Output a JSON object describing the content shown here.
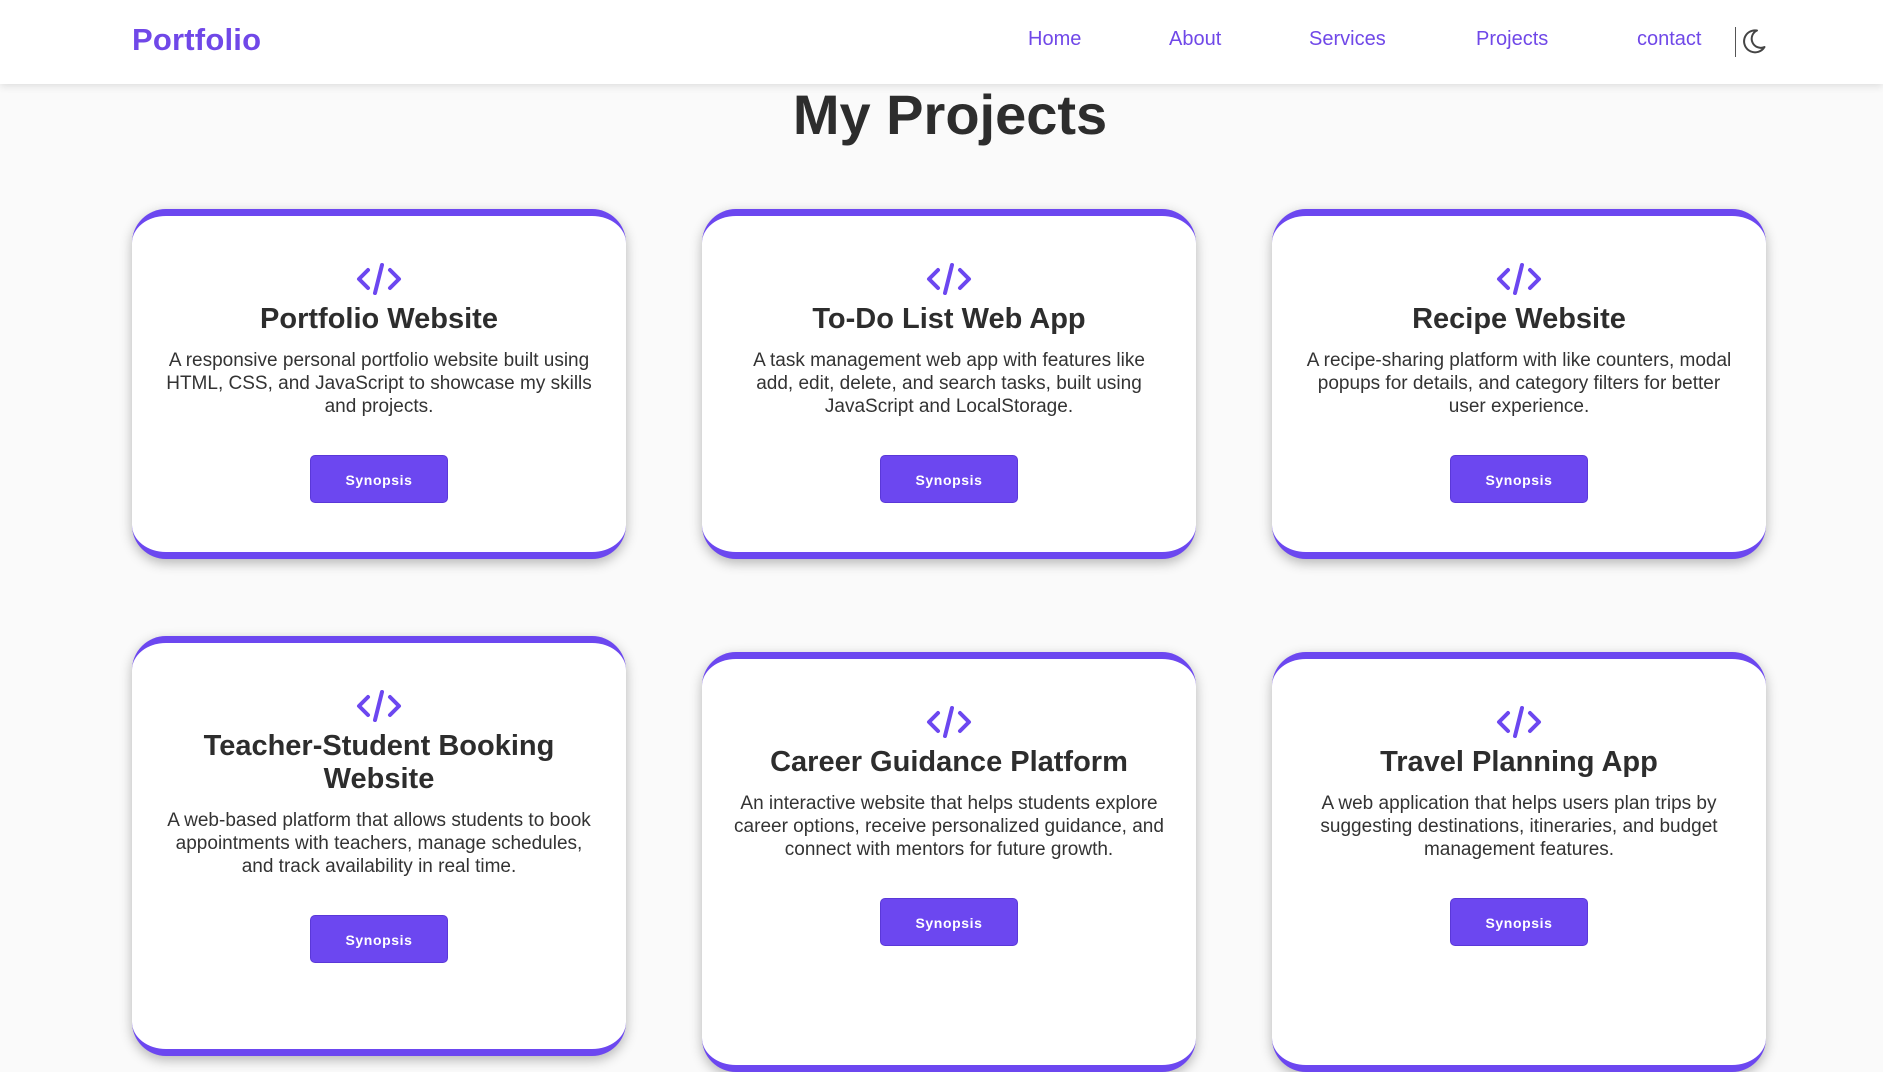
{
  "nav": {
    "logo": "Portfolio",
    "links": [
      "Home",
      "About",
      "Services",
      "Projects",
      "contact"
    ],
    "theme_icon": "moon-icon"
  },
  "page_title": "My Projects",
  "colors": {
    "accent": "#6c47f0",
    "link": "#7048e8",
    "text": "#2d2d2d",
    "background": "#fafafa"
  },
  "projects": [
    {
      "icon": "code-icon",
      "title": "Portfolio Website",
      "description": "A responsive personal portfolio website built using HTML, CSS, and JavaScript to showcase my skills and projects.",
      "button": "Synopsis"
    },
    {
      "icon": "code-icon",
      "title": "To-Do List Web App",
      "description": "A task management web app with features like add, edit, delete, and search tasks, built using JavaScript and LocalStorage.",
      "button": "Synopsis"
    },
    {
      "icon": "code-icon",
      "title": "Recipe Website",
      "description": "A recipe-sharing platform with like counters, modal popups for details, and category filters for better user experience.",
      "button": "Synopsis"
    },
    {
      "icon": "code-icon",
      "title": "Teacher-Student Booking Website",
      "description": "A web-based platform that allows students to book appointments with teachers, manage schedules, and track availability in real time.",
      "button": "Synopsis"
    },
    {
      "icon": "code-icon",
      "title": "Career Guidance Platform",
      "description": "An interactive website that helps students explore career options, receive personalized guidance, and connect with mentors for future growth.",
      "button": "Synopsis"
    },
    {
      "icon": "code-icon",
      "title": "Travel Planning App",
      "description": "A web application that helps users plan trips by suggesting destinations, itineraries, and budget management features.",
      "button": "Synopsis"
    }
  ]
}
